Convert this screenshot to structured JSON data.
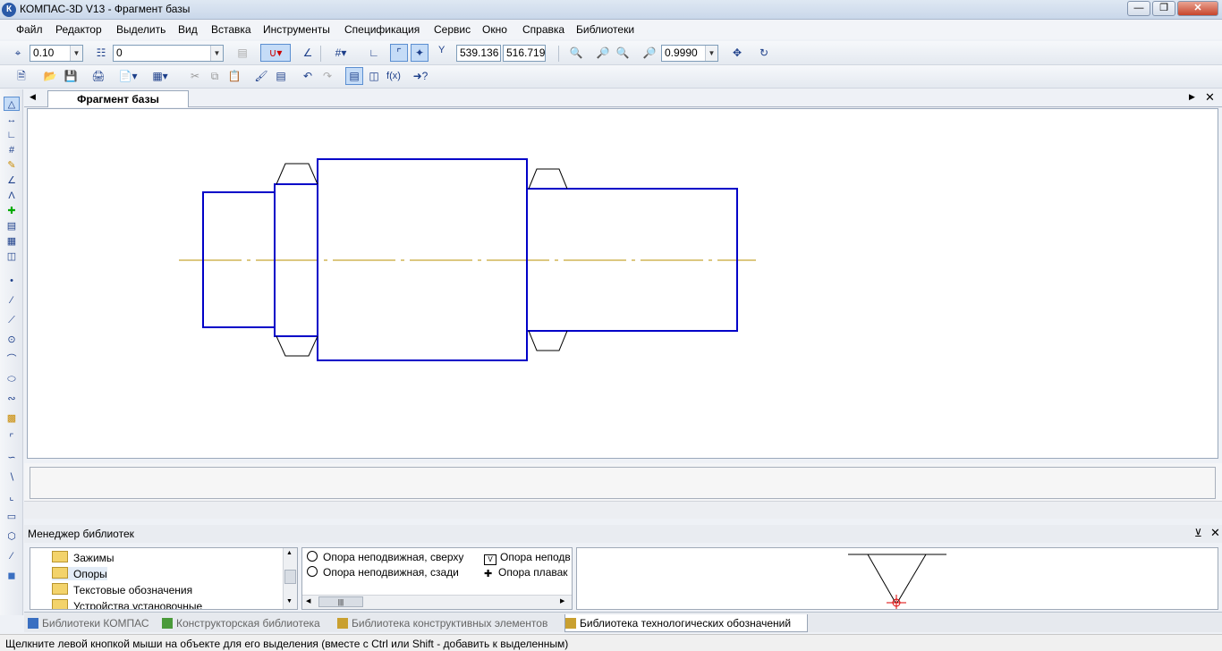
{
  "window": {
    "title": "КОМПАС-3D V13 - Фрагмент базы",
    "app_icon": "К"
  },
  "menu": [
    "Файл",
    "Редактор",
    "Выделить",
    "Вид",
    "Вставка",
    "Инструменты",
    "Спецификация",
    "Сервис",
    "Окно",
    "Справка",
    "Библиотеки"
  ],
  "toolbar1": {
    "step": "0.10",
    "layer": "0",
    "coord_x_label": "Y",
    "coord_x": "539.136",
    "coord_y": "516.719",
    "zoom": "0.9990"
  },
  "document_tab": "Фрагмент базы",
  "library_manager": {
    "title": "Менеджер библиотек",
    "tree": [
      "Зажимы",
      "Опоры",
      "Текстовые обозначения",
      "Устройства установочные"
    ],
    "selected": "Опоры",
    "items_col1": [
      "Опора неподвижная, сверху",
      "Опора неподвижная, сзади"
    ],
    "items_col2": [
      "Опора неподв",
      "Опора плавак"
    ]
  },
  "library_tabs": [
    "Библиотеки КОМПАС",
    "Конструкторская библиотека",
    "Библиотека конструктивных элементов",
    "Библиотека технологических обозначений"
  ],
  "active_library_tab": 3,
  "status": "Щелкните левой кнопкой мыши на объекте для его выделения (вместе с Ctrl или Shift - добавить к выделенным)",
  "colors": {
    "drawing": "#0000c8",
    "axis": "#b89000",
    "accent": "#3a6fc1"
  }
}
